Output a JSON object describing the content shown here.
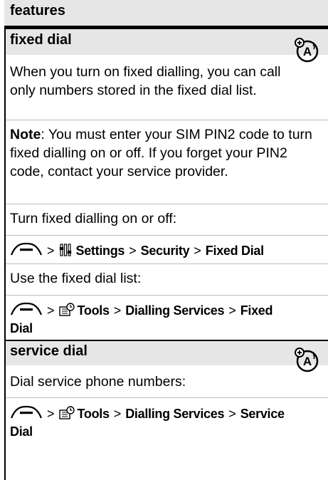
{
  "header": {
    "title": "features"
  },
  "sections": [
    {
      "title": "fixed dial",
      "intro": "When you turn on fixed dialling, you can call only numbers stored in the fixed dial list.",
      "note_label": "Note",
      "note_text": ": You must enter your SIM PIN2 code to turn fixed dialling on or off. If you forget your PIN2 code, contact your service provider.",
      "instruction_1": "Turn fixed dialling on or off:",
      "path_1": [
        "Settings",
        "Security",
        "Fixed Dial"
      ],
      "instruction_2": "Use the fixed dial list:",
      "path_2": [
        "Tools",
        "Dialling Services",
        "Fixed",
        "Dial"
      ]
    },
    {
      "title": "service dial",
      "instruction_1": "Dial service phone numbers:",
      "path_1": [
        "Tools",
        "Dialling Services",
        "Service",
        "Dial"
      ]
    }
  ],
  "icons": {
    "feature": "network-operator-feature-icon",
    "menu_key": "menu-key-icon",
    "settings": "settings-icon",
    "tools": "tools-icon"
  },
  "separator": ">"
}
